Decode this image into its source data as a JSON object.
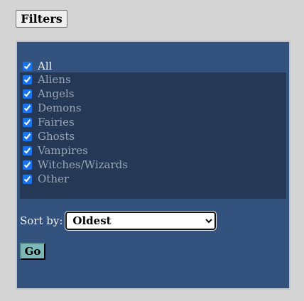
{
  "filters_button": {
    "label": "Filters"
  },
  "all_option": {
    "label": "All",
    "checked": true
  },
  "categories": [
    {
      "label": "Aliens",
      "checked": true
    },
    {
      "label": "Angels",
      "checked": true
    },
    {
      "label": "Demons",
      "checked": true
    },
    {
      "label": "Fairies",
      "checked": true
    },
    {
      "label": "Ghosts",
      "checked": true
    },
    {
      "label": "Vampires",
      "checked": true
    },
    {
      "label": "Witches/Wizards",
      "checked": true
    },
    {
      "label": "Other",
      "checked": true
    }
  ],
  "sort": {
    "label": "Sort by:",
    "selected": "Oldest"
  },
  "go_button": {
    "label": "Go"
  },
  "colors": {
    "page_background": "#d4d4d4",
    "panel_background": "#34527e",
    "list_background": "#253957",
    "go_button": "#7db8b8"
  }
}
